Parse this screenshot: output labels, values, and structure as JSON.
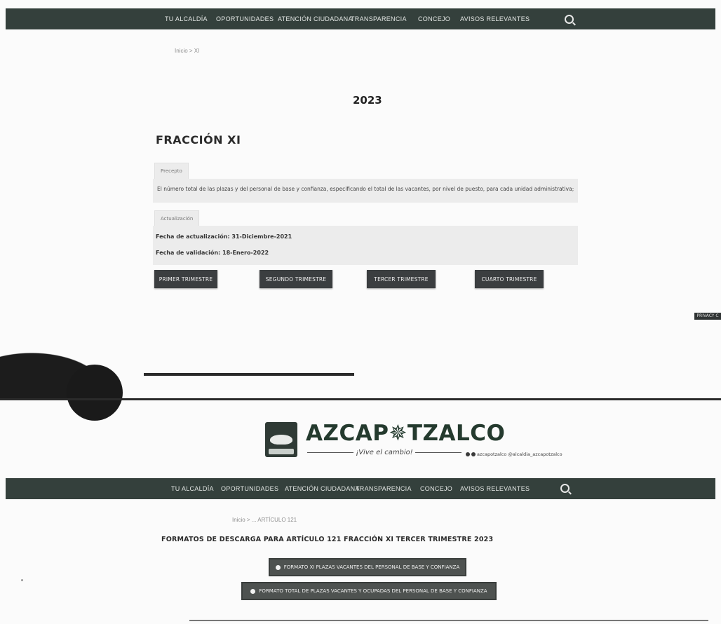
{
  "nav_top": {
    "items": [
      "TU ALCALDÍA",
      "OPORTUNIDADES",
      "ATENCIÓN CIUDADANA",
      "TRANSPARENCIA",
      "CONCEJO",
      "AVISOS RELEVANTES"
    ]
  },
  "top_page": {
    "breadcrumb": "Inicio > XI",
    "year": "2023",
    "fraccion_title": "FRACCIÓN XI",
    "tab_precepto": "Precepto",
    "precepto_text": "El número total de las plazas y del personal de base y confianza, especificando el total de las vacantes, por nivel de puesto, para cada unidad administrativa;",
    "tab_actualizacion": "Actualización",
    "fecha_actualizacion": "Fecha de actualización: 31-Diciembre-2021",
    "fecha_validacion": "Fecha de validación: 18-Enero-2022",
    "trimestres": [
      "PRIMER TRIMESTRE",
      "SEGUNDO TRIMESTRE",
      "TERCER TRIMESTRE",
      "CUARTO TRIMESTRE"
    ],
    "side_tag": "PRIVACY C"
  },
  "brand": {
    "name": "AZCAP✵TZALCO",
    "tagline": "¡Vive el cambio!",
    "social_handle": "azcapotzalco @alcaldia_azcapotzalco"
  },
  "nav_bottom": {
    "items": [
      "TU ALCALDÍA",
      "OPORTUNIDADES",
      "ATENCIÓN CIUDADANA",
      "TRANSPARENCIA",
      "CONCEJO",
      "AVISOS RELEVANTES"
    ]
  },
  "bottom_page": {
    "breadcrumb": "Inicio > ... ARTÍCULO 121",
    "formatos_title": "FORMATOS DE DESCARGA PARA ARTÍCULO 121 FRACCIÓN XI TERCER TRIMESTRE 2023",
    "download_1": "FORMATO XI PLAZAS VACANTES DEL PERSONAL DE BASE Y CONFIANZA",
    "download_2": "FORMATO TOTAL DE PLAZAS VACANTES Y OCUPADAS DEL PERSONAL DE BASE Y CONFIANZA"
  }
}
